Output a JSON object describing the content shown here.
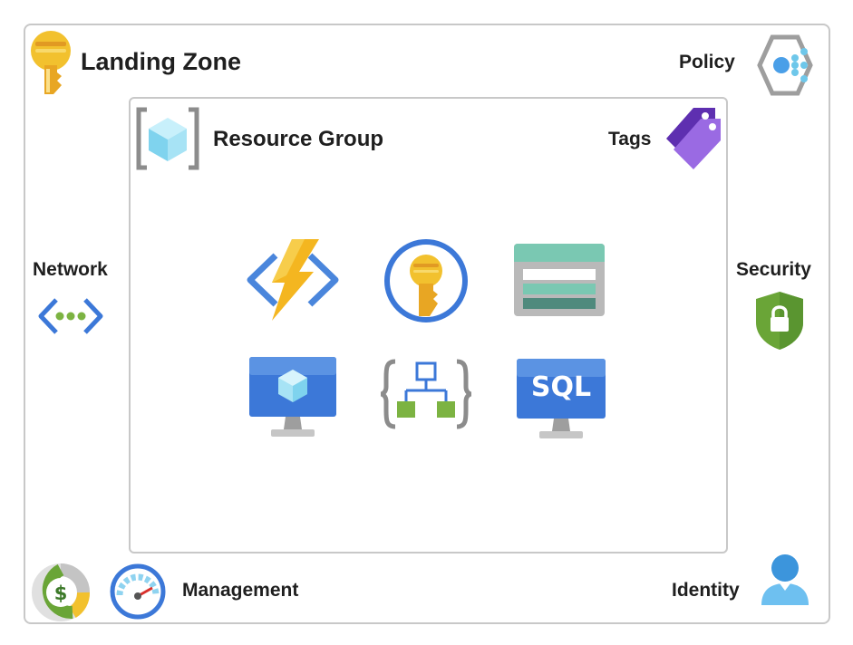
{
  "landing_zone": {
    "title": "Landing Zone",
    "policy_label": "Policy",
    "network_label": "Network",
    "security_label": "Security",
    "management_label": "Management",
    "identity_label": "Identity"
  },
  "resource_group": {
    "title": "Resource Group",
    "tags_label": "Tags",
    "resources": [
      {
        "icon": "function-app-icon"
      },
      {
        "icon": "key-vault-icon"
      },
      {
        "icon": "storage-account-icon"
      },
      {
        "icon": "virtual-machine-icon"
      },
      {
        "icon": "resource-template-icon"
      },
      {
        "icon": "sql-server-icon",
        "text": "SQL"
      }
    ]
  },
  "colors": {
    "frame_border": "#c8c8c8",
    "azure_blue": "#3c78d8",
    "key_yellow": "#f2c12e",
    "security_green": "#6aa537",
    "tag_purple": "#8a4fd8"
  }
}
